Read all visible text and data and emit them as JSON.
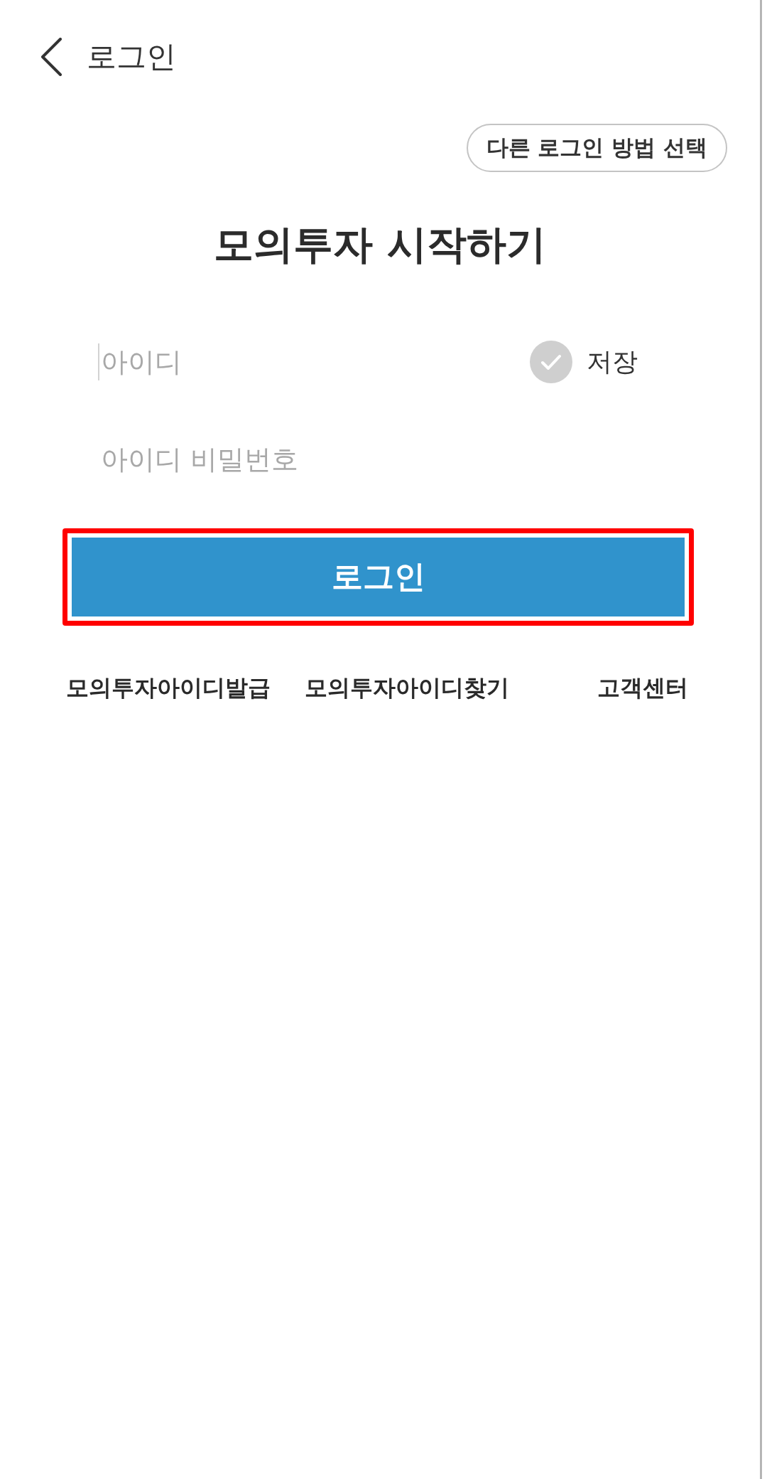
{
  "header": {
    "title": "로그인"
  },
  "other_login_button": {
    "label": "다른 로그인 방법 선택"
  },
  "heading": "모의투자 시작하기",
  "id_field": {
    "placeholder": "아이디",
    "focused": true
  },
  "save_id": {
    "label": "저장",
    "checked": false
  },
  "password_field": {
    "placeholder": "아이디 비밀번호",
    "focused": false
  },
  "login_button": {
    "label": "로그인",
    "highlighted": true
  },
  "links": [
    {
      "label": "모의투자아이디발급"
    },
    {
      "label": "모의투자아이디찾기"
    },
    {
      "label": "고객센터"
    }
  ]
}
